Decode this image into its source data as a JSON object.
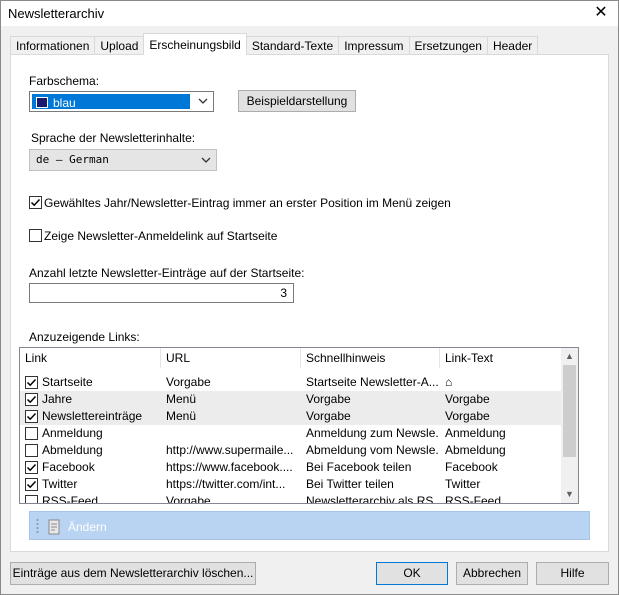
{
  "window": {
    "title": "Newsletterarchiv"
  },
  "tabs": [
    {
      "label": "Informationen",
      "active": false
    },
    {
      "label": "Upload",
      "active": false
    },
    {
      "label": "Erscheinungsbild",
      "active": true
    },
    {
      "label": "Standard-Texte",
      "active": false
    },
    {
      "label": "Impressum",
      "active": false
    },
    {
      "label": "Ersetzungen",
      "active": false
    },
    {
      "label": "Header",
      "active": false
    }
  ],
  "farbschema": {
    "label": "Farbschema:",
    "value": "blau",
    "swatch_color": "#1a1a6e",
    "preview_button": "Beispieldarstellung"
  },
  "sprache": {
    "label": "Sprache der Newsletterinhalte:",
    "value": "de – German"
  },
  "options": {
    "first_position": {
      "label": "Gewähltes Jahr/Newsletter-Eintrag immer an erster Position im Menü zeigen",
      "checked": true
    },
    "signup_link": {
      "label": "Zeige Newsletter-Anmeldelink auf Startseite",
      "checked": false
    }
  },
  "anzahl": {
    "label": "Anzahl letzte Newsletter-Einträge auf der Startseite:",
    "value": "3"
  },
  "links": {
    "label": "Anzuzeigende Links:",
    "columns": [
      "Link",
      "URL",
      "Schnellhinweis",
      "Link-Text"
    ],
    "rows": [
      {
        "checked": true,
        "link": "Startseite",
        "url": "Vorgabe",
        "hint": "Startseite Newsletter-A...",
        "text": "⌂",
        "shaded": false
      },
      {
        "checked": true,
        "link": "Jahre",
        "url": "Menü",
        "hint": "Vorgabe",
        "text": "Vorgabe",
        "shaded": true
      },
      {
        "checked": true,
        "link": "Newslettereinträge",
        "url": "Menü",
        "hint": "Vorgabe",
        "text": "Vorgabe",
        "shaded": true
      },
      {
        "checked": false,
        "link": "Anmeldung",
        "url": "",
        "hint": "Anmeldung zum Newsle...",
        "text": "Anmeldung",
        "shaded": false
      },
      {
        "checked": false,
        "link": "Abmeldung",
        "url": "http://www.supermaile...",
        "hint": "Abmeldung vom Newsle...",
        "text": "Abmeldung",
        "shaded": false
      },
      {
        "checked": true,
        "link": "Facebook",
        "url": "https://www.facebook....",
        "hint": "Bei Facebook teilen",
        "text": "Facebook",
        "shaded": false
      },
      {
        "checked": true,
        "link": "Twitter",
        "url": "https://twitter.com/int...",
        "hint": "Bei Twitter teilen",
        "text": "Twitter",
        "shaded": false
      },
      {
        "checked": false,
        "link": "RSS-Feed",
        "url": "Vorgabe",
        "hint": "Newsletterarchiv als RS...",
        "text": "RSS-Feed",
        "shaded": false
      }
    ]
  },
  "edit_toolbar": {
    "label": "Ändern"
  },
  "footer": {
    "delete_button": "Einträge aus dem Newsletterarchiv löschen...",
    "ok_button": "OK",
    "cancel_button": "Abbrechen",
    "help_button": "Hilfe"
  }
}
